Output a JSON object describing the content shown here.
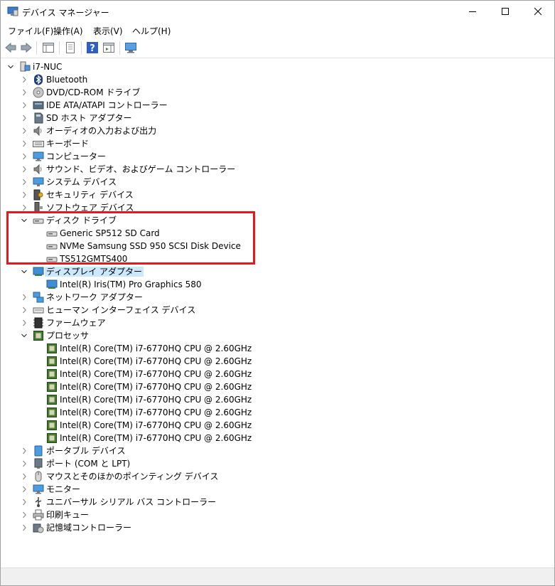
{
  "window": {
    "title": "デバイス マネージャー"
  },
  "titlebar_icons": {
    "app": "device-manager-icon",
    "minimize": "minimize-icon",
    "maximize": "maximize-icon",
    "close": "close-icon"
  },
  "menu": [
    {
      "label": "ファイル(F)"
    },
    {
      "label": "操作(A)"
    },
    {
      "label": "表示(V)"
    },
    {
      "label": "ヘルプ(H)"
    }
  ],
  "toolbar": [
    "back-arrow-icon",
    "forward-arrow-icon",
    "show-hide-console-tree-icon",
    "properties-icon",
    "help-icon",
    "action-pane-icon",
    "scan-hardware-icon"
  ],
  "tree": [
    {
      "label": "i7-NUC",
      "level": 0,
      "expander": "expanded",
      "icon": "computer-root-icon"
    },
    {
      "label": "Bluetooth",
      "level": 1,
      "expander": "collapsed",
      "icon": "bluetooth-icon"
    },
    {
      "label": "DVD/CD-ROM ドライブ",
      "level": 1,
      "expander": "collapsed",
      "icon": "dvd-drive-icon"
    },
    {
      "label": "IDE ATA/ATAPI コントローラー",
      "level": 1,
      "expander": "collapsed",
      "icon": "ide-controller-icon"
    },
    {
      "label": "SD ホスト アダプター",
      "level": 1,
      "expander": "collapsed",
      "icon": "sd-host-adapter-icon"
    },
    {
      "label": "オーディオの入力および出力",
      "level": 1,
      "expander": "collapsed",
      "icon": "speaker-icon"
    },
    {
      "label": "キーボード",
      "level": 1,
      "expander": "collapsed",
      "icon": "keyboard-icon"
    },
    {
      "label": "コンピューター",
      "level": 1,
      "expander": "collapsed",
      "icon": "monitor-icon"
    },
    {
      "label": "サウンド、ビデオ、およびゲーム コントローラー",
      "level": 1,
      "expander": "collapsed",
      "icon": "speaker-icon"
    },
    {
      "label": "システム デバイス",
      "level": 1,
      "expander": "collapsed",
      "icon": "system-device-icon"
    },
    {
      "label": "セキュリティ デバイス",
      "level": 1,
      "expander": "collapsed",
      "icon": "security-key-icon"
    },
    {
      "label": "ソフトウェア デバイス",
      "level": 1,
      "expander": "collapsed",
      "icon": "software-device-icon"
    },
    {
      "label": "ディスク ドライブ",
      "level": 1,
      "expander": "expanded",
      "icon": "disk-drive-icon"
    },
    {
      "label": "Generic SP512 SD Card",
      "level": 2,
      "expander": "none",
      "icon": "disk-drive-icon"
    },
    {
      "label": "NVMe Samsung SSD 950 SCSI Disk Device",
      "level": 2,
      "expander": "none",
      "icon": "disk-drive-icon"
    },
    {
      "label": "TS512GMTS400",
      "level": 2,
      "expander": "none",
      "icon": "disk-drive-icon"
    },
    {
      "label": "ディスプレイ アダプター",
      "level": 1,
      "expander": "expanded",
      "icon": "display-adapter-icon",
      "selected": true
    },
    {
      "label": "Intel(R) Iris(TM) Pro Graphics 580",
      "level": 2,
      "expander": "none",
      "icon": "display-adapter-icon"
    },
    {
      "label": "ネットワーク アダプター",
      "level": 1,
      "expander": "collapsed",
      "icon": "network-adapter-icon"
    },
    {
      "label": "ヒューマン インターフェイス デバイス",
      "level": 1,
      "expander": "collapsed",
      "icon": "hid-icon"
    },
    {
      "label": "ファームウェア",
      "level": 1,
      "expander": "collapsed",
      "icon": "firmware-icon"
    },
    {
      "label": "プロセッサ",
      "level": 1,
      "expander": "expanded",
      "icon": "processor-icon"
    },
    {
      "label": "Intel(R) Core(TM) i7-6770HQ CPU @ 2.60GHz",
      "level": 2,
      "expander": "none",
      "icon": "processor-icon"
    },
    {
      "label": "Intel(R) Core(TM) i7-6770HQ CPU @ 2.60GHz",
      "level": 2,
      "expander": "none",
      "icon": "processor-icon"
    },
    {
      "label": "Intel(R) Core(TM) i7-6770HQ CPU @ 2.60GHz",
      "level": 2,
      "expander": "none",
      "icon": "processor-icon"
    },
    {
      "label": "Intel(R) Core(TM) i7-6770HQ CPU @ 2.60GHz",
      "level": 2,
      "expander": "none",
      "icon": "processor-icon"
    },
    {
      "label": "Intel(R) Core(TM) i7-6770HQ CPU @ 2.60GHz",
      "level": 2,
      "expander": "none",
      "icon": "processor-icon"
    },
    {
      "label": "Intel(R) Core(TM) i7-6770HQ CPU @ 2.60GHz",
      "level": 2,
      "expander": "none",
      "icon": "processor-icon"
    },
    {
      "label": "Intel(R) Core(TM) i7-6770HQ CPU @ 2.60GHz",
      "level": 2,
      "expander": "none",
      "icon": "processor-icon"
    },
    {
      "label": "Intel(R) Core(TM) i7-6770HQ CPU @ 2.60GHz",
      "level": 2,
      "expander": "none",
      "icon": "processor-icon"
    },
    {
      "label": "ポータブル デバイス",
      "level": 1,
      "expander": "collapsed",
      "icon": "portable-device-icon"
    },
    {
      "label": "ポート (COM と LPT)",
      "level": 1,
      "expander": "collapsed",
      "icon": "port-icon"
    },
    {
      "label": "マウスとそのほかのポインティング デバイス",
      "level": 1,
      "expander": "collapsed",
      "icon": "mouse-icon"
    },
    {
      "label": "モニター",
      "level": 1,
      "expander": "collapsed",
      "icon": "monitor-icon"
    },
    {
      "label": "ユニバーサル シリアル バス コントローラー",
      "level": 1,
      "expander": "collapsed",
      "icon": "usb-icon"
    },
    {
      "label": "印刷キュー",
      "level": 1,
      "expander": "collapsed",
      "icon": "printer-icon"
    },
    {
      "label": "記憶域コントローラー",
      "level": 1,
      "expander": "collapsed",
      "icon": "storage-controller-icon"
    }
  ],
  "colors": {
    "selection": "#cce8ff",
    "annotation": "#e8171f",
    "processor_green": "#3d7a2a"
  }
}
